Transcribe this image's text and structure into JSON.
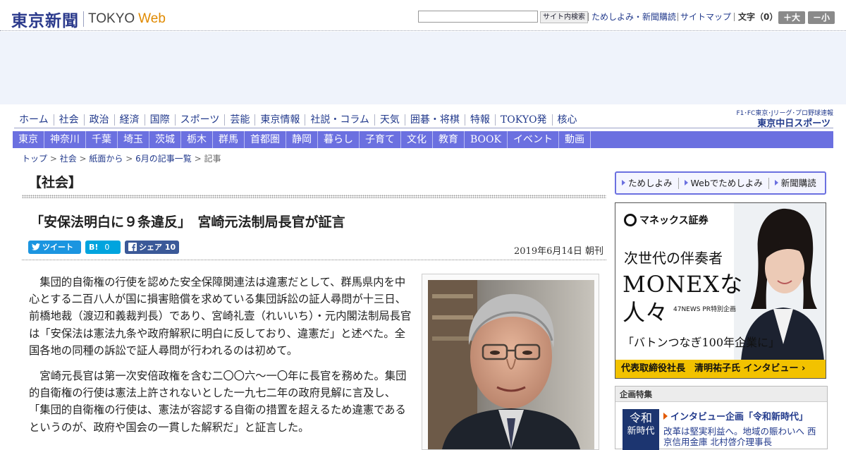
{
  "header": {
    "logo_jp": "東京新聞",
    "logo_en": "TOKYO",
    "logo_web": "Web",
    "search_placeholder": "",
    "search_button": "サイト内検索",
    "links": [
      "ためしよみ・新聞購読",
      "サイトマップ"
    ],
    "font_size_label": "文字（0）",
    "font_larger": "＋大",
    "font_smaller": "－小"
  },
  "nav_primary": [
    "ホーム",
    "社会",
    "政治",
    "経済",
    "国際",
    "スポーツ",
    "芸能",
    "東京情報",
    "社説・コラム",
    "天気",
    "囲碁・将棋",
    "特報",
    "TOKYO発",
    "核心"
  ],
  "chunichi": {
    "small": "F1･FC東京･Jリーグ･プロ野球速報",
    "big": "東京中日スポーツ"
  },
  "nav_regional": [
    "東京",
    "神奈川",
    "千葉",
    "埼玉",
    "茨城",
    "栃木",
    "群馬",
    "首都圏",
    "静岡",
    "暮らし",
    "子育て",
    "文化",
    "教育",
    "BOOK",
    "イベント",
    "動画"
  ],
  "breadcrumb": {
    "items": [
      "トップ",
      "社会",
      "紙面から",
      "6月の記事一覧"
    ],
    "current": "記事",
    "sep": " > "
  },
  "section_title": "【社会】",
  "article": {
    "headline": "「安保法明白に９条違反」　宮崎元法制局長官が証言",
    "date": "2019年6月14日 朝刊",
    "share": {
      "tweet": "ツイート",
      "hatena": "B!",
      "hatena_count": "0",
      "fb": "シェア",
      "fb_count": "10"
    },
    "paragraphs": [
      "集団的自衛権の行使を認めた安全保障関連法は違憲だとして、群馬県内を中心とする二百八人が国に損害賠償を求めている集団訴訟の証人尋問が十三日、前橋地裁（渡辺和義裁判長）であり、宮崎礼壹（れいいち）・元内閣法制局長官は「安保法は憲法九条や政府解釈に明白に反しており、違憲だ」と述べた。全国各地の同種の訴訟で証人尋問が行われるのは初めて。",
      "宮崎元長官は第一次安倍政権を含む二〇〇六～一〇年に長官を務めた。集団的自衛権の行使は憲法上許されないとした一九七二年の政府見解に言及し、「集団的自衛権の行使は、憲法が容認する自衛の措置を超えるため違憲であるというのが、政府や国会の一貫した解釈だ」と証言した。"
    ]
  },
  "sidebar": {
    "promo": [
      "ためしよみ",
      "Webでためしよみ",
      "新聞購読"
    ],
    "ad": {
      "brand": "マネックス証券",
      "line1": "次世代の伴奏者",
      "line2": "MONEXな",
      "line3": "人々",
      "pr": "47NEWS PR特別企画",
      "quote": "「バトンつなぎ100年企業に」",
      "bar": "代表取締役社長　清明祐子氏 インタビュー ›"
    },
    "feature": {
      "header": "企画特集",
      "thumb_a": "令和",
      "thumb_b": "新時代",
      "title": "インタビュー企画「令和新時代」",
      "desc": "改革は堅実利益へ。地域の賑わいへ 西京信用金庫 北村啓介理事長"
    }
  },
  "colors": {
    "brand_blue": "#223a8c",
    "nav_purple": "#6b70e0",
    "tweet": "#1b95e0",
    "hatena": "#00a4de",
    "facebook": "#3b5998",
    "ad_yellow": "#f2c200"
  }
}
